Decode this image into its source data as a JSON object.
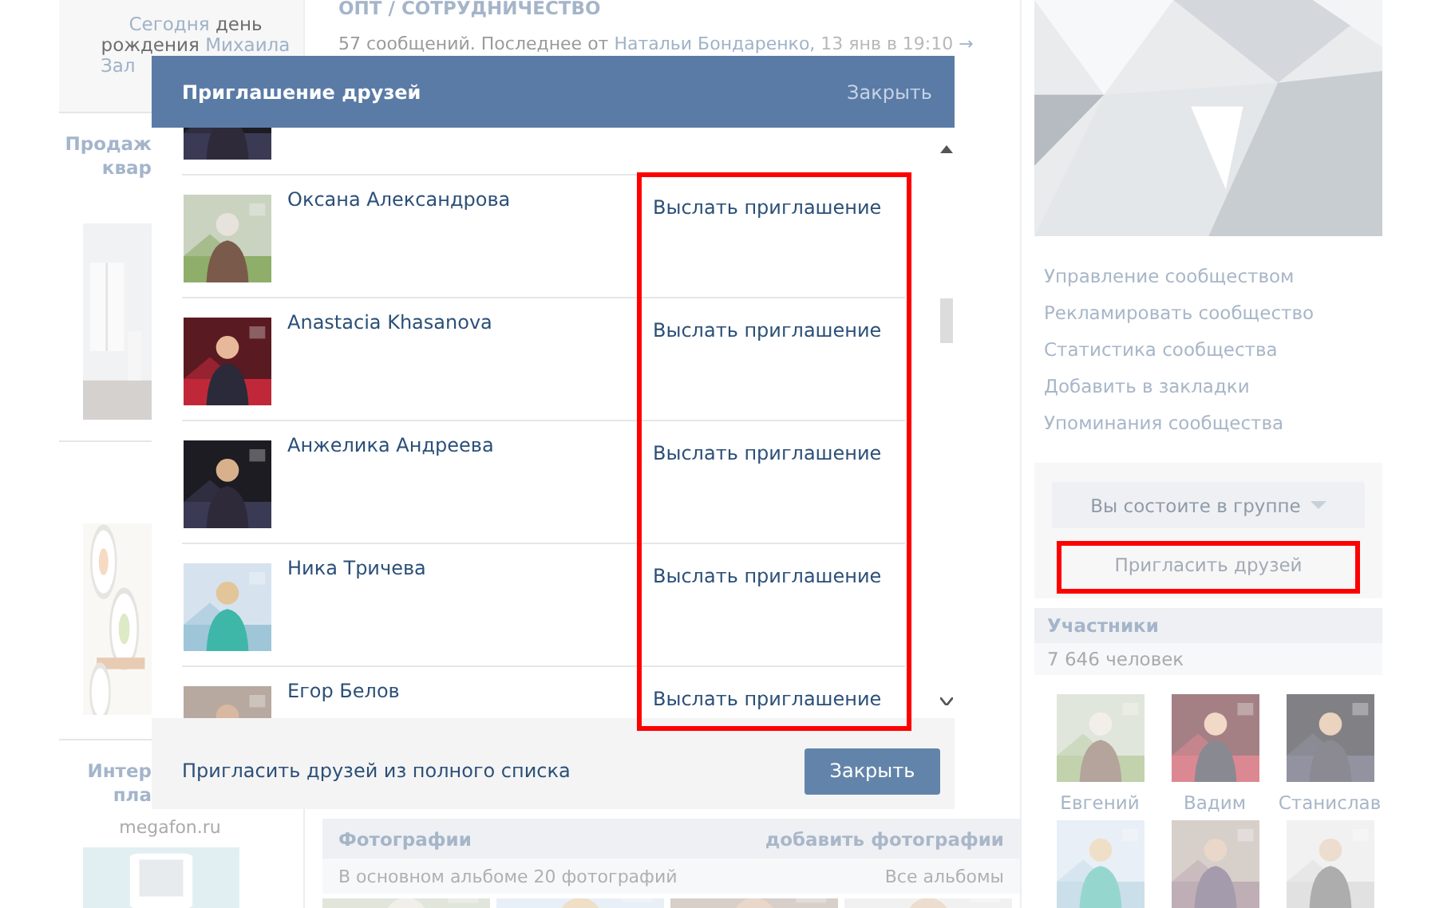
{
  "page": {
    "left": {
      "birthday": [
        {
          "text": "Сегодня",
          "link": true
        },
        {
          "text": "день рождения",
          "link": false
        },
        {
          "text": "Михаила",
          "link": true
        },
        {
          "text": "Зал",
          "link": true
        }
      ],
      "ad_titles": [
        [
          "Продаж",
          "квар"
        ],
        [
          "Интер",
          "пла"
        ]
      ],
      "ad_domain": "megafon.ru"
    },
    "middle": {
      "topic_title": "ОПТ / СОТРУДНИЧЕСТВО",
      "topic_meta": "57 сообщений. Последнее от",
      "topic_author": "Натальи Бондаренко,",
      "topic_date": "13 янв в 19:10",
      "topic_arrow": "→",
      "photos": {
        "title": "Фотографии",
        "add": "добавить фотографии",
        "count": "В основном альбоме 20 фотографий",
        "all": "Все альбомы"
      }
    },
    "right": {
      "links": [
        "Управление сообществом",
        "Рекламировать сообщество",
        "Статистика сообщества",
        "Добавить в закладки",
        "Упоминания сообщества"
      ],
      "membership_button": "Вы состоите в группе",
      "invite": {
        "label": "Пригласить друзей",
        "highlighted": true
      },
      "members_title": "Участники",
      "members_count": "7 646 человек",
      "members": [
        {
          "name": "Евгений"
        },
        {
          "name": "Вадим"
        },
        {
          "name": "Станислав"
        },
        {
          "kind": "picture"
        },
        {
          "kind": "picture"
        },
        {
          "kind": "picture"
        }
      ]
    }
  },
  "modal": {
    "title": "Приглашение друзей",
    "close": "Закрыть",
    "actions_highlighted": true,
    "friends": [
      {
        "name": "Оксана Александрова",
        "action": "Выслать приглашение"
      },
      {
        "name": "Anastacia Khasanova",
        "action": "Выслать приглашение"
      },
      {
        "name": "Анжелика Андреева",
        "action": "Выслать приглашение"
      },
      {
        "name": "Ника Тричева",
        "action": "Выслать приглашение"
      },
      {
        "name": "Егор Белов",
        "action": "Выслать приглашение"
      }
    ],
    "footer_link": "Пригласить друзей из полного списка",
    "footer_button": "Закрыть"
  }
}
